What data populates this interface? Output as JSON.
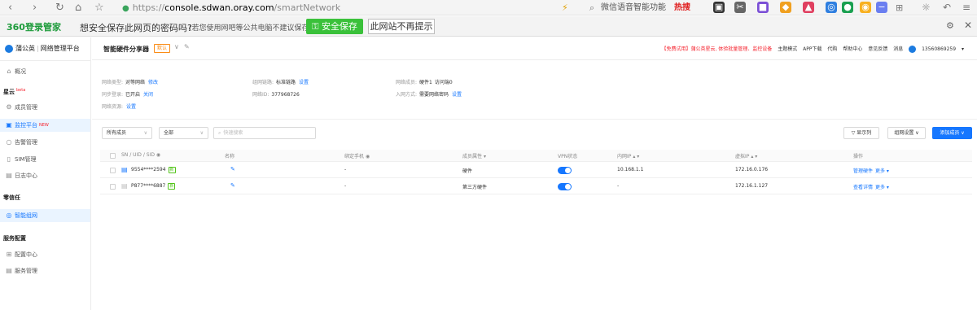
{
  "browser": {
    "url_scheme": "https://",
    "url_host": "console.sdwan.oray.com",
    "url_path": "/smartNetwork",
    "voice_search": "微信语音智能功能",
    "hot_label": "热搜"
  },
  "password_bar": {
    "logo": "360登录管家",
    "question": "想安全保存此网页的密码吗?",
    "note": "(若您使用网吧等公共电脑不建议保存)",
    "save_label": "安全保存",
    "never_label": "此网站不再提示"
  },
  "sidebar": {
    "brand": "蒲公英",
    "brand_sub": "网络管理平台",
    "overview": "概况",
    "section_xingyun": "星云",
    "beta": "beta",
    "member_mgmt": "成员管理",
    "monitor_platform": "监控平台",
    "new_badge": "NEW",
    "alarm_mgmt": "告警管理",
    "sim_mgmt": "SIM管理",
    "log_center": "日志中心",
    "section_zero_trust": "零信任",
    "smart_network": "智能组网",
    "section_service": "服务配置",
    "config_center": "配置中心",
    "service_mgmt": "服务管理"
  },
  "header": {
    "title": "智能硬件分享器",
    "badge": "默认",
    "promo": "【免费试用】蒲公英星云, 体验批量管理、监控设备",
    "links": [
      "主题模式",
      "APP下载",
      "代购",
      "帮助中心",
      "意见反馈",
      "消息"
    ],
    "phone": "13560869259"
  },
  "info": {
    "net_type_label": "网络类型:",
    "net_type_value": "对等网络",
    "net_type_link": "修改",
    "sync_label": "同步登录:",
    "sync_value": "已开启",
    "sync_link": "关闭",
    "resource_label": "网络资源:",
    "resource_link": "设置",
    "link_label": "组网链路:",
    "link_value": "标准链路",
    "link_link": "设置",
    "netid_label": "网络ID:",
    "netid_value": "377968726",
    "members_label": "网络成员:",
    "members_value": "硬件1",
    "members_visitor": "访问端0",
    "join_label": "入网方式:",
    "join_value": "需要网络密码",
    "join_link": "设置"
  },
  "toolbar": {
    "filter_members": "所有成员",
    "filter_all": "全部",
    "search_placeholder": "快速搜索",
    "show_columns": "显示列",
    "net_settings": "组网设置",
    "add_member": "添加成员"
  },
  "table": {
    "headers": [
      "SN / UID / SID",
      "名称",
      "绑定手机",
      "成员属性",
      "VPN状态",
      "内网IP",
      "虚拟IP",
      "操作"
    ],
    "rows": [
      {
        "sn": "9554****2594",
        "tag": "新",
        "phone": "-",
        "attr": "硬件",
        "lan_ip": "10.168.1.1",
        "vip": "172.16.0.176",
        "op1": "管理硬件",
        "op2": "更多"
      },
      {
        "sn": "P877****6887",
        "tag": "新",
        "phone": "-",
        "attr": "第三方硬件",
        "lan_ip": "-",
        "vip": "172.16.1.127",
        "op1": "查看详情",
        "op2": "更多"
      }
    ]
  }
}
